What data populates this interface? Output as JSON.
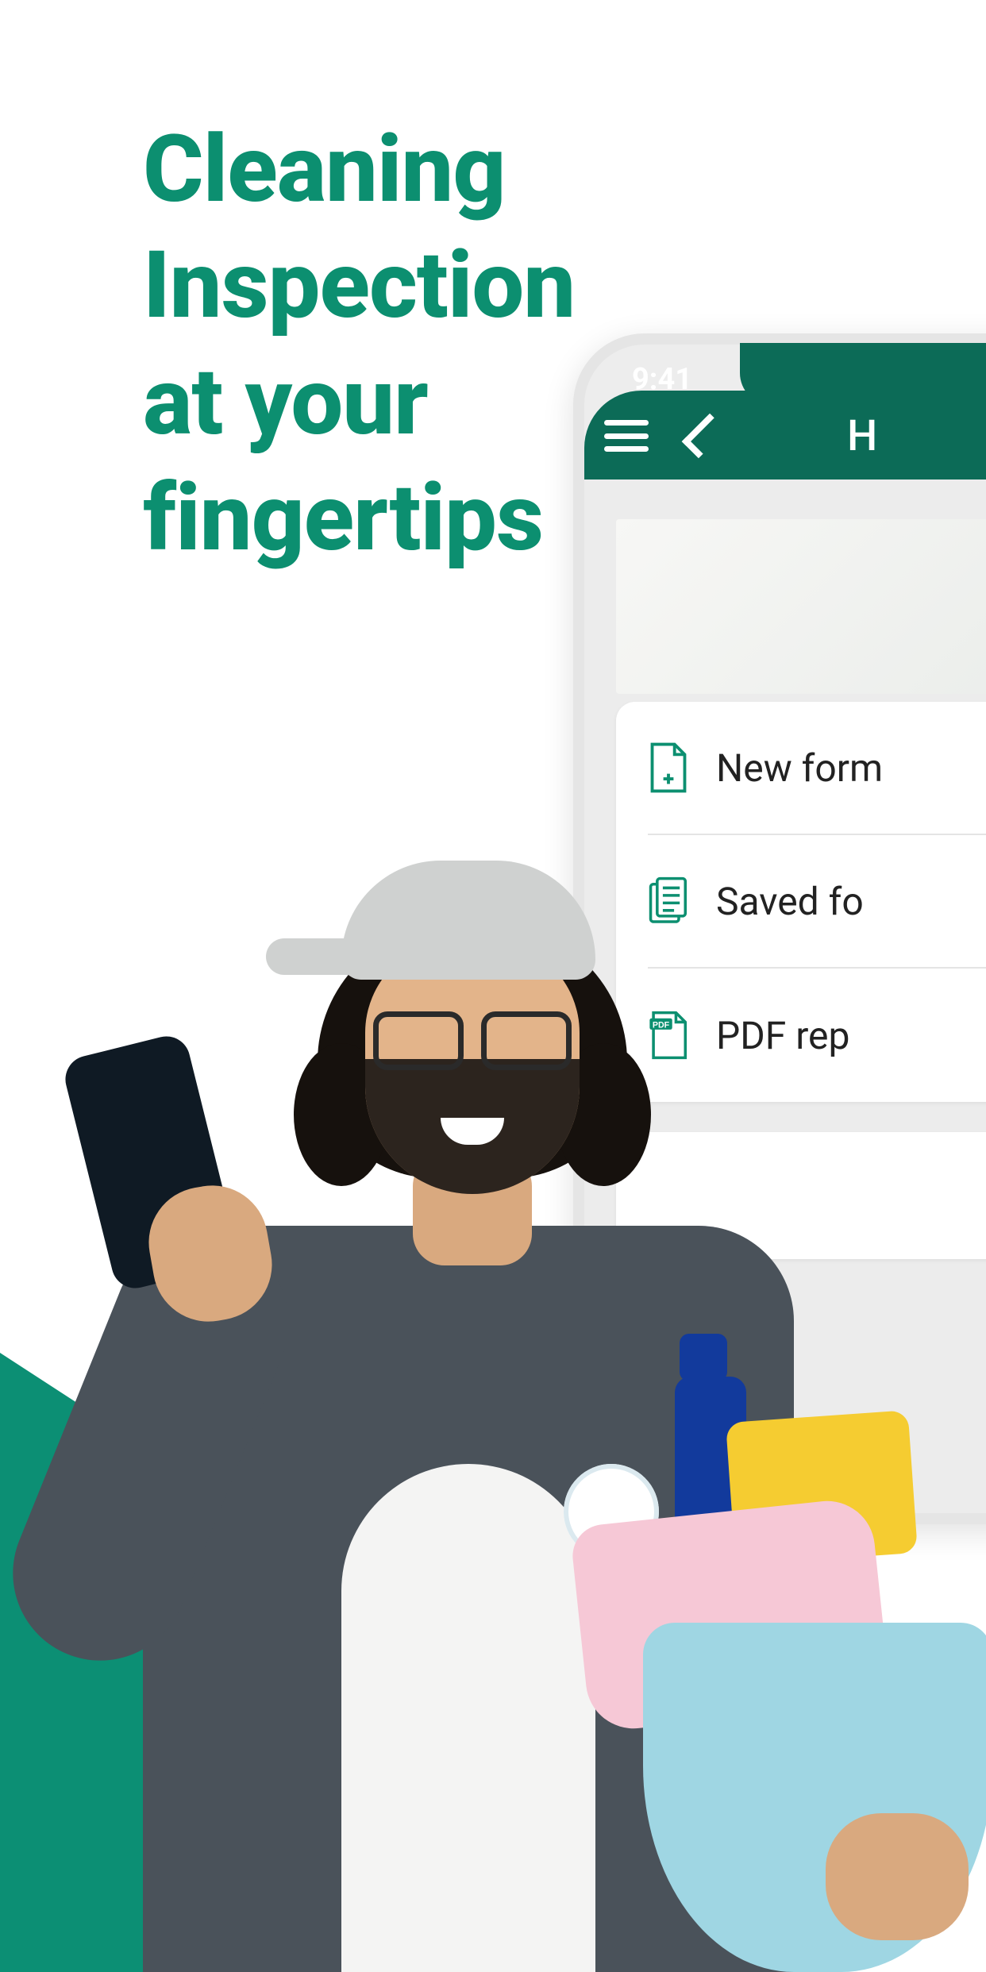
{
  "colors": {
    "brand": "#0c8f70",
    "barGreen": "#0c6b57",
    "shapeGreen": "#0c8f74"
  },
  "headline": {
    "line1": "Cleaning",
    "line2": "Inspection",
    "line3": "at your",
    "line4": "fingertips"
  },
  "phone": {
    "status_time": "9:41",
    "app_bar": {
      "title_letter": "H"
    },
    "menu": [
      {
        "icon": "new-form-icon",
        "label": "New form"
      },
      {
        "icon": "saved-form-icon",
        "label": "Saved fo"
      },
      {
        "icon": "pdf-report-icon",
        "label": "PDF rep"
      }
    ],
    "share_icon": "share-icon"
  }
}
